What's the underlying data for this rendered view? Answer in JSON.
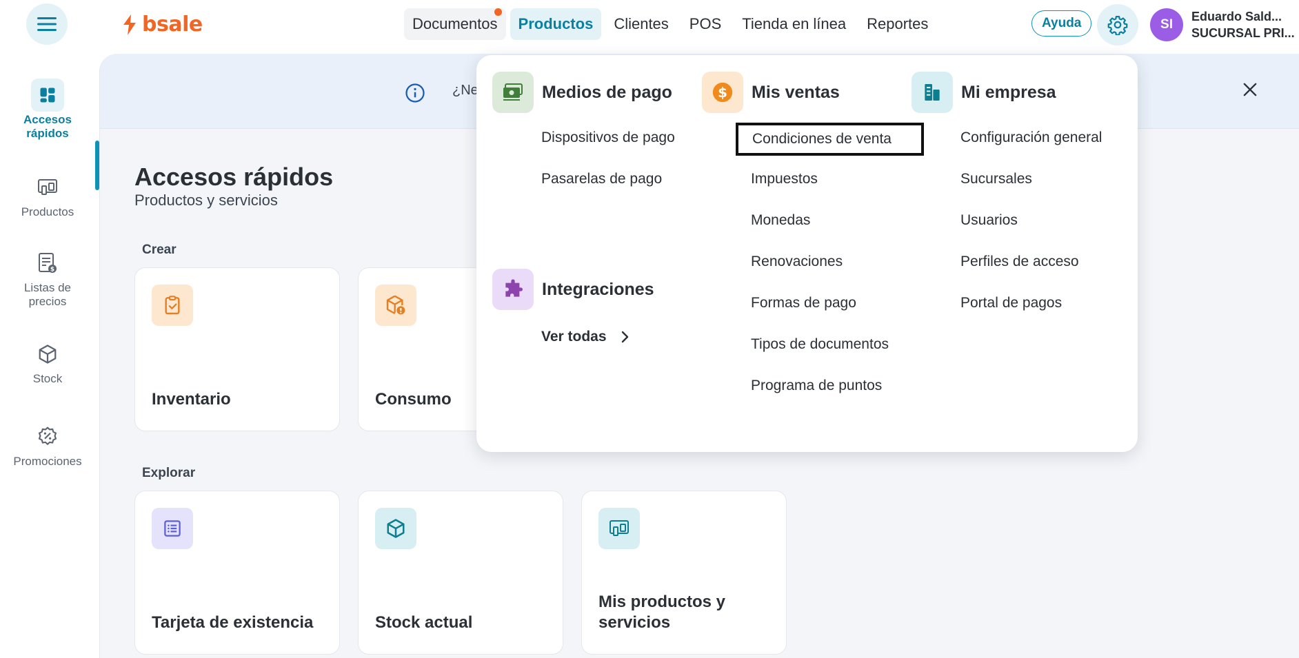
{
  "brand": {
    "name": "bsale"
  },
  "header": {
    "nav": [
      {
        "label": "Documentos",
        "has_notification": true
      },
      {
        "label": "Productos",
        "active": true
      },
      {
        "label": "Clientes"
      },
      {
        "label": "POS"
      },
      {
        "label": "Tienda en línea"
      },
      {
        "label": "Reportes"
      }
    ],
    "help_label": "Ayuda",
    "user": {
      "initials": "SI",
      "name": "Eduardo Sald...",
      "branch": "SUCURSAL PRI..."
    }
  },
  "sidebar": {
    "items": [
      {
        "label": "Accesos rápidos",
        "icon": "dashboard-icon",
        "active": true
      },
      {
        "label": "Productos",
        "icon": "products-icon"
      },
      {
        "label": "Listas de precios",
        "icon": "price-list-icon"
      },
      {
        "label": "Stock",
        "icon": "box-icon"
      },
      {
        "label": "Promociones",
        "icon": "promotion-badge-icon"
      }
    ]
  },
  "banner": {
    "text": "¿Ne"
  },
  "main": {
    "title": "Accesos rápidos",
    "subtitle": "Productos y servicios",
    "sections": [
      {
        "label": "Crear",
        "cards": [
          {
            "title": "Inventario"
          },
          {
            "title": "Consumo"
          }
        ]
      },
      {
        "label": "Explorar",
        "cards": [
          {
            "title": "Tarjeta de existencia"
          },
          {
            "title": "Stock actual"
          },
          {
            "title": "Mis productos y servicios"
          }
        ]
      }
    ]
  },
  "dropdown": {
    "medios_pago": {
      "title": "Medios de pago",
      "links": [
        "Dispositivos de pago",
        "Pasarelas de pago"
      ]
    },
    "integraciones": {
      "title": "Integraciones",
      "link": "Ver todas"
    },
    "mis_ventas": {
      "title": "Mis ventas",
      "links": [
        "Condiciones de venta",
        "Impuestos",
        "Monedas",
        "Renovaciones",
        "Formas de pago",
        "Tipos de documentos",
        "Programa de puntos"
      ]
    },
    "mi_empresa": {
      "title": "Mi empresa",
      "links": [
        "Configuración general",
        "Sucursales",
        "Usuarios",
        "Perfiles de acceso",
        "Portal de pagos"
      ]
    }
  },
  "colors": {
    "accent": "#0b93b8",
    "brand": "#f26522",
    "avatar": "#9b5de5"
  }
}
